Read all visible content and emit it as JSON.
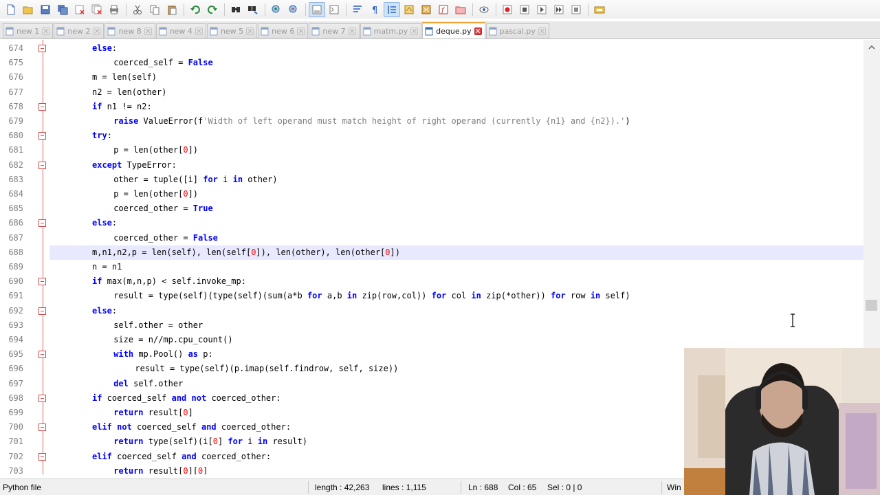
{
  "toolbar": {
    "buttons": [
      "new-file",
      "open-file",
      "save",
      "save-all",
      "close",
      "close-all",
      "print",
      "cut",
      "copy",
      "paste",
      "undo",
      "redo",
      "find",
      "replace",
      "zoom-in",
      "zoom-out",
      "sync-vertical",
      "sync-horizontal",
      "word-wrap",
      "show-all-chars",
      "indent-guide",
      "user-defined-language",
      "document-map",
      "function-list",
      "folder-as-workspace",
      "monitoring",
      "record-macro",
      "stop-recording",
      "playback",
      "run-macro-multiple",
      "save-macro",
      "run"
    ]
  },
  "tabs": [
    {
      "label": "new 1",
      "active": false
    },
    {
      "label": "new 2",
      "active": false
    },
    {
      "label": "new 8",
      "active": false
    },
    {
      "label": "new 4",
      "active": false
    },
    {
      "label": "new 5",
      "active": false
    },
    {
      "label": "new 6",
      "active": false
    },
    {
      "label": "new 7",
      "active": false
    },
    {
      "label": "matm.py",
      "active": false
    },
    {
      "label": "deque.py",
      "active": true
    },
    {
      "label": "pascal.py",
      "active": false
    }
  ],
  "editor": {
    "current_line": 688,
    "lines": [
      {
        "n": "674",
        "indent": 2,
        "text": "else:"
      },
      {
        "n": "675",
        "indent": 3,
        "text": "coerced_self = False"
      },
      {
        "n": "676",
        "indent": 2,
        "text": "m = len(self)"
      },
      {
        "n": "677",
        "indent": 2,
        "text": "n2 = len(other)"
      },
      {
        "n": "678",
        "indent": 2,
        "text": "if n1 != n2:"
      },
      {
        "n": "679",
        "indent": 3,
        "text": "raise ValueError(f'Width of left operand must match height of right operand (currently {n1} and {n2}).')"
      },
      {
        "n": "680",
        "indent": 2,
        "text": "try:"
      },
      {
        "n": "681",
        "indent": 3,
        "text": "p = len(other[0])"
      },
      {
        "n": "682",
        "indent": 2,
        "text": "except TypeError:"
      },
      {
        "n": "683",
        "indent": 3,
        "text": "other = tuple([i] for i in other)"
      },
      {
        "n": "684",
        "indent": 3,
        "text": "p = len(other[0])"
      },
      {
        "n": "685",
        "indent": 3,
        "text": "coerced_other = True"
      },
      {
        "n": "686",
        "indent": 2,
        "text": "else:"
      },
      {
        "n": "687",
        "indent": 3,
        "text": "coerced_other = False"
      },
      {
        "n": "688",
        "indent": 2,
        "text": "m,n1,n2,p = len(self), len(self[0]), len(other), len(other[0])"
      },
      {
        "n": "689",
        "indent": 2,
        "text": "n = n1"
      },
      {
        "n": "690",
        "indent": 2,
        "text": "if max(m,n,p) < self.invoke_mp:"
      },
      {
        "n": "691",
        "indent": 3,
        "text": "result = type(self)(type(self)(sum(a*b for a,b in zip(row,col)) for col in zip(*other)) for row in self)"
      },
      {
        "n": "692",
        "indent": 2,
        "text": "else:"
      },
      {
        "n": "693",
        "indent": 3,
        "text": "self.other = other"
      },
      {
        "n": "694",
        "indent": 3,
        "text": "size = n//mp.cpu_count()"
      },
      {
        "n": "695",
        "indent": 3,
        "text": "with mp.Pool() as p:"
      },
      {
        "n": "696",
        "indent": 4,
        "text": "result = type(self)(p.imap(self.findrow, self, size))"
      },
      {
        "n": "697",
        "indent": 3,
        "text": "del self.other"
      },
      {
        "n": "698",
        "indent": 2,
        "text": "if coerced_self and not coerced_other:"
      },
      {
        "n": "699",
        "indent": 3,
        "text": "return result[0]"
      },
      {
        "n": "700",
        "indent": 2,
        "text": "elif not coerced_self and coerced_other:"
      },
      {
        "n": "701",
        "indent": 3,
        "text": "return type(self)(i[0] for i in result)"
      },
      {
        "n": "702",
        "indent": 2,
        "text": "elif coerced_self and coerced_other:"
      },
      {
        "n": "703",
        "indent": 3,
        "text": "return result[0][0]"
      }
    ],
    "fold_markers": [
      "674",
      "678",
      "680",
      "682",
      "686",
      "690",
      "692",
      "695",
      "698",
      "700",
      "702"
    ]
  },
  "status": {
    "file_type": "Python file",
    "length": "length : 42,263",
    "lines": "lines : 1,115",
    "ln": "Ln : 688",
    "col": "Col : 65",
    "sel": "Sel : 0 | 0",
    "eol": "Win"
  },
  "colors": {
    "keyword": "#0000ff",
    "number": "#ff0000",
    "string": "#808080",
    "current_line_bg": "#e8e8ff",
    "active_tab_accent": "#f3a436"
  }
}
